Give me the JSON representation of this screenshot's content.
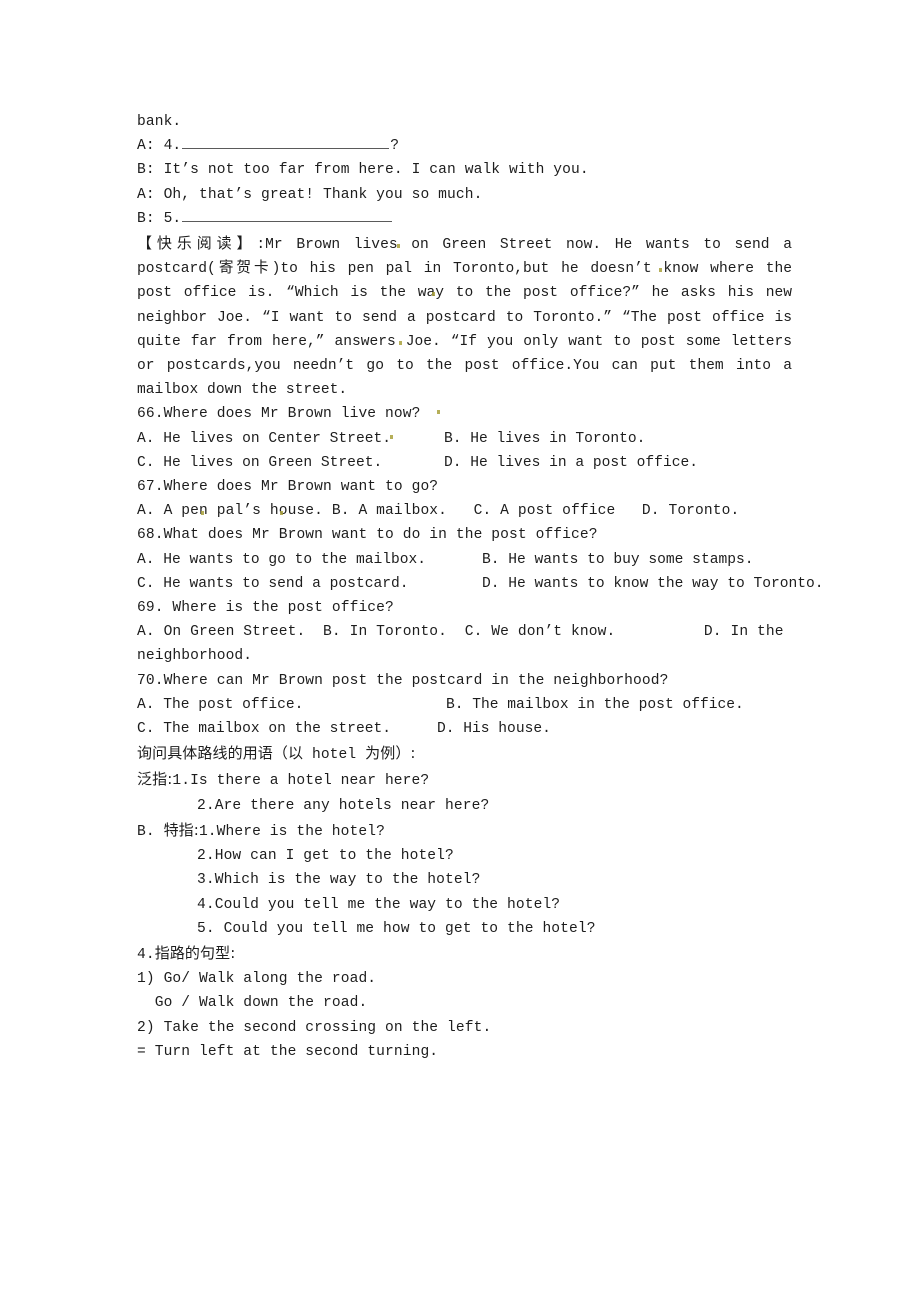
{
  "document": {
    "type": "english-worksheet-page",
    "language_mix": [
      "en",
      "zh-Hans"
    ],
    "background_color": "#ffffff",
    "text_color": "#1d1d1d",
    "rule_color": "#5a5a5a",
    "artifact_color": "#a9a13c"
  },
  "dialogue": {
    "line_bank": "bank.",
    "line_a4_prefix": "A: 4.",
    "line_a4_suffix": "?",
    "line_b_walk": "B: It’s not too far from here. I can walk with you.",
    "line_a_thanks": "A: Oh, that’s great! Thank you so much.",
    "line_b5_prefix": "B: 5."
  },
  "reading": {
    "header_cjk": "【快乐阅读】",
    "header_colon": ":",
    "passage": "Mr Brown lives on Green Street now. He wants to send a postcard(寄贺卡)to his pen pal in Toronto,but he doesn’t know where the post office is. “Which is the way to the post office?” he asks his new neighbor Joe. “I want to send a postcard to Toronto.” “The post office is quite far from here,” answers Joe. “If you only want to post some letters or postcards,you needn’t go to the post office.You can put them into a mailbox down the street."
  },
  "questions": [
    {
      "number": "66.",
      "stem": "66.Where does Mr Brown live now?",
      "rows": [
        {
          "left": "A. He lives on Center Street.",
          "right": "B. He lives in Toronto."
        },
        {
          "left": "C. He lives on Green Street.",
          "right": "D. He lives in a post office."
        }
      ]
    },
    {
      "number": "67.",
      "stem": "67.Where does Mr Brown want to go?",
      "single_line": "A. A pen pal’s house. B. A mailbox.   C. A post office   D. Toronto."
    },
    {
      "number": "68.",
      "stem": "68.What does Mr Brown want to do in the post office?",
      "rows": [
        {
          "left": "A. He wants to go to the mailbox.",
          "right": "B. He wants to buy some stamps."
        },
        {
          "left": "C. He wants to send a postcard.",
          "right": "D. He wants to know the way to Toronto."
        }
      ]
    },
    {
      "number": "69.",
      "stem": "69. Where is the post office?",
      "justified_line": "A. On Green Street.  B. In Toronto.  C. We don’t know.          D. In the",
      "wrap_line": "neighborhood."
    },
    {
      "number": "70.",
      "stem": "70.Where can Mr Brown post the postcard in the neighborhood?",
      "rows": [
        {
          "left": "A. The post office.",
          "right": "B. The mailbox in the post office."
        },
        {
          "left": "C. The mailbox on the street.",
          "right": "D. His house."
        }
      ]
    }
  ],
  "notes_section": {
    "heading_cjk_a": "询问具体路线的用语（以",
    "heading_latin": " hotel ",
    "heading_cjk_b": "为例）:",
    "general_label_cjk": "泛指:",
    "general_items": [
      "1.Is there a hotel near here?",
      "2.Are there any hotels near here?"
    ],
    "specific_prefix": "B. ",
    "specific_label_cjk": "特指:",
    "specific_first": "1.Where is the hotel?",
    "specific_items": [
      "2.How can I get to the hotel?",
      "3.Which is the way to the hotel?",
      "4.Could you tell me the way to the hotel?",
      "5. Could you tell me how to get to the hotel?"
    ]
  },
  "directions_section": {
    "heading_number": "4.",
    "heading_cjk": "指路的句型:",
    "lines": [
      "1) Go/ Walk along the road.",
      "  Go / Walk down the road.",
      "2) Take the second crossing on the left.",
      "= Turn left at the second turning."
    ]
  }
}
